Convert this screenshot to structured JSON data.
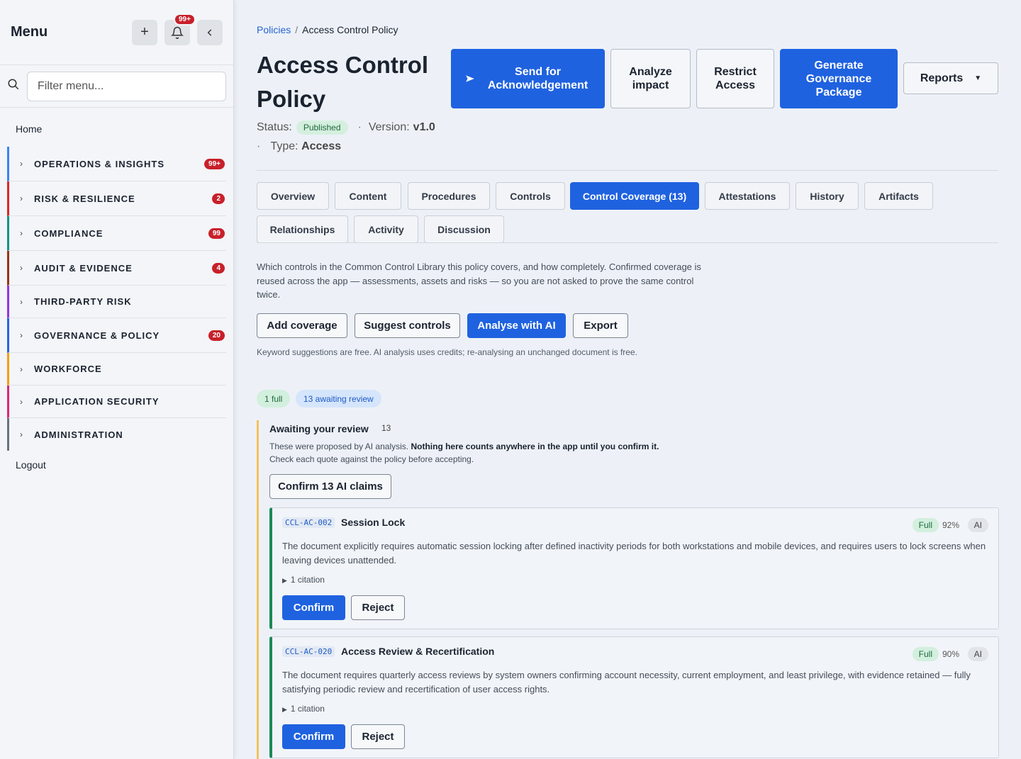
{
  "sidebar": {
    "title": "Menu",
    "notif_badge": "99+",
    "filter_placeholder": "Filter menu...",
    "home": "Home",
    "logout": "Logout",
    "items": [
      {
        "label": "OPERATIONS & INSIGHTS",
        "count": "99+",
        "color": "#3b82f6"
      },
      {
        "label": "RISK & RESILIENCE",
        "count": "2",
        "color": "#dc2626"
      },
      {
        "label": "COMPLIANCE",
        "count": "99",
        "color": "#0d9488"
      },
      {
        "label": "AUDIT & EVIDENCE",
        "count": "4",
        "color": "#9a3412"
      },
      {
        "label": "THIRD-PARTY RISK",
        "count": "",
        "color": "#9333ea"
      },
      {
        "label": "GOVERNANCE & POLICY",
        "count": "20",
        "color": "#2563eb"
      },
      {
        "label": "WORKFORCE",
        "count": "",
        "color": "#f59e0b"
      },
      {
        "label": "APPLICATION SECURITY",
        "count": "",
        "color": "#db2777"
      },
      {
        "label": "ADMINISTRATION",
        "count": "",
        "color": "#6b7280"
      }
    ]
  },
  "breadcrumb": {
    "parent": "Policies",
    "separator": "/",
    "current": "Access Control Policy"
  },
  "page": {
    "title": "Access Control Policy",
    "status_label": "Status:",
    "status_value": "Published",
    "version_label": "Version:",
    "version_value": "v1.0",
    "type_label": "Type:",
    "type_value": "Access"
  },
  "header_buttons": {
    "send": "Send for Acknowledgement",
    "analyze": "Analyze impact",
    "restrict": "Restrict Access",
    "generate": "Generate Governance Package",
    "reports": "Reports"
  },
  "tabs": [
    "Overview",
    "Content",
    "Procedures",
    "Controls",
    "Control Coverage (13)",
    "Attestations",
    "History",
    "Artifacts",
    "Relationships",
    "Activity",
    "Discussion"
  ],
  "active_tab": "Control Coverage (13)",
  "coverage": {
    "description": "Which controls in the Common Control Library this policy covers, and how completely. Confirmed coverage is reused across the app — assessments, assets and risks — so you are not asked to prove the same control twice.",
    "actions": {
      "add": "Add coverage",
      "suggest": "Suggest controls",
      "analyse": "Analyse with AI",
      "export": "Export"
    },
    "note": "Keyword suggestions are free. AI analysis uses credits; re-analysing an unchanged document is free.",
    "chips": {
      "full": "1 full",
      "awaiting": "13 awaiting review"
    }
  },
  "review": {
    "title": "Awaiting your review",
    "count": "13",
    "text_a": "These were proposed by AI analysis. ",
    "text_bold": "Nothing here counts anywhere in the app until you confirm it.",
    "text_b": "Check each quote against the policy before accepting.",
    "confirm_all": "Confirm 13 AI claims"
  },
  "cards": [
    {
      "code": "CCL-AC-002",
      "name": "Session Lock",
      "level": "Full",
      "pct": "92%",
      "source": "AI",
      "text": "The document explicitly requires automatic session locking after defined inactivity periods for both workstations and mobile devices, and requires users to lock screens when leaving devices unattended.",
      "citation": "1 citation",
      "confirm": "Confirm",
      "reject": "Reject"
    },
    {
      "code": "CCL-AC-020",
      "name": "Access Review & Recertification",
      "level": "Full",
      "pct": "90%",
      "source": "AI",
      "text": "The document requires quarterly access reviews by system owners confirming account necessity, current employment, and least privilege, with evidence retained — fully satisfying periodic review and recertification of user access rights.",
      "citation": "1 citation",
      "confirm": "Confirm",
      "reject": "Reject"
    }
  ]
}
